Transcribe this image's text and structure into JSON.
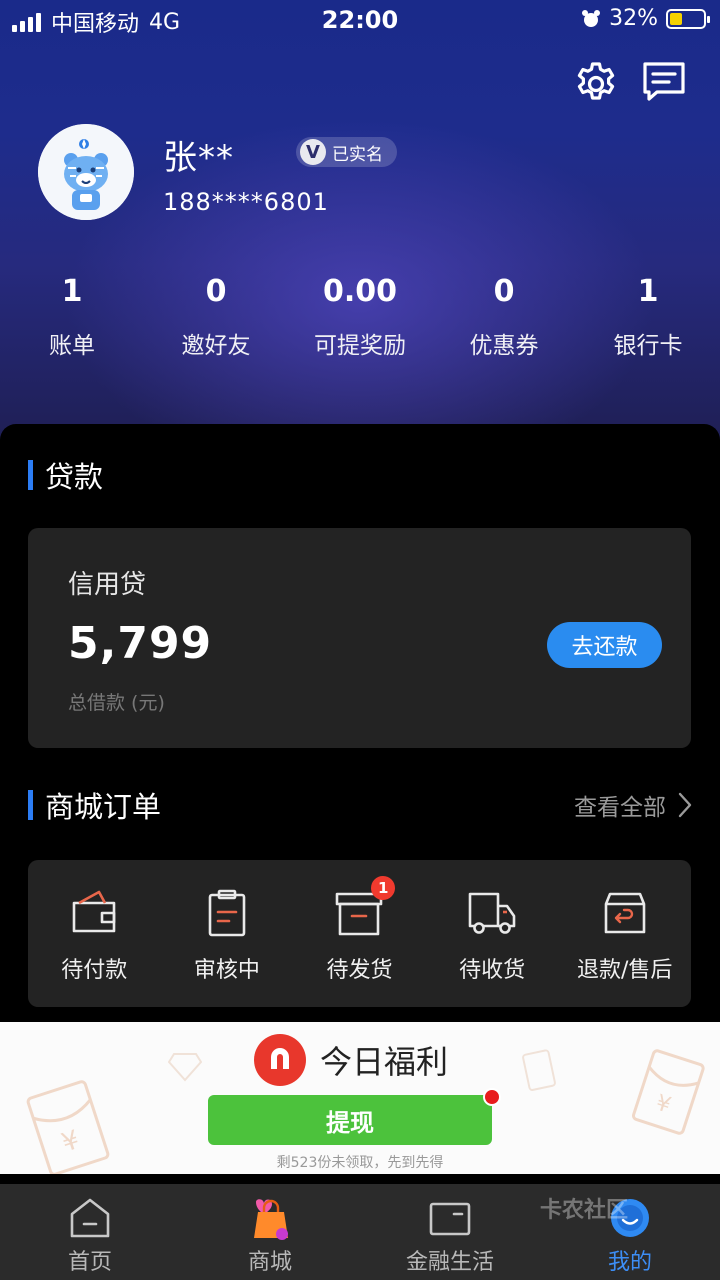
{
  "status_bar": {
    "carrier": "中国移动",
    "network": "4G",
    "time": "22:00",
    "battery": "32%",
    "battery_level": 0.32
  },
  "profile": {
    "name": "张**",
    "verified_label": "已实名",
    "verified_mark": "V",
    "phone": "188****6801"
  },
  "stats": [
    {
      "value": "1",
      "label": "账单"
    },
    {
      "value": "0",
      "label": "邀好友"
    },
    {
      "value": "0.00",
      "label": "可提奖励"
    },
    {
      "value": "0",
      "label": "优惠券"
    },
    {
      "value": "1",
      "label": "银行卡"
    }
  ],
  "loan": {
    "section_title": "贷款",
    "product": "信用贷",
    "amount": "5,799",
    "amount_caption": "总借款 (元)",
    "repay_button": "去还款"
  },
  "orders": {
    "section_title": "商城订单",
    "view_all": "查看全部",
    "items": [
      {
        "label": "待付款",
        "icon": "wallet-icon",
        "badge": ""
      },
      {
        "label": "审核中",
        "icon": "clipboard-icon",
        "badge": ""
      },
      {
        "label": "待发货",
        "icon": "box-icon",
        "badge": "1"
      },
      {
        "label": "待收货",
        "icon": "truck-icon",
        "badge": ""
      },
      {
        "label": "退款/售后",
        "icon": "return-box-icon",
        "badge": ""
      }
    ]
  },
  "ad": {
    "title": "今日福利",
    "button": "提现",
    "note": "剩523份未领取，先到先得"
  },
  "tabs": [
    {
      "label": "首页",
      "icon": "home-icon",
      "active": false
    },
    {
      "label": "商城",
      "icon": "shopping-bag-icon",
      "active": false
    },
    {
      "label": "金融生活",
      "icon": "card-icon",
      "active": false
    },
    {
      "label": "我的",
      "icon": "profile-icon",
      "active": true
    }
  ],
  "watermark": "卡农社区",
  "colors": {
    "accent": "#2c7df5",
    "badge": "#f03a2e",
    "ad_button": "#4cc23c",
    "tab_active": "#3d8ef5"
  }
}
